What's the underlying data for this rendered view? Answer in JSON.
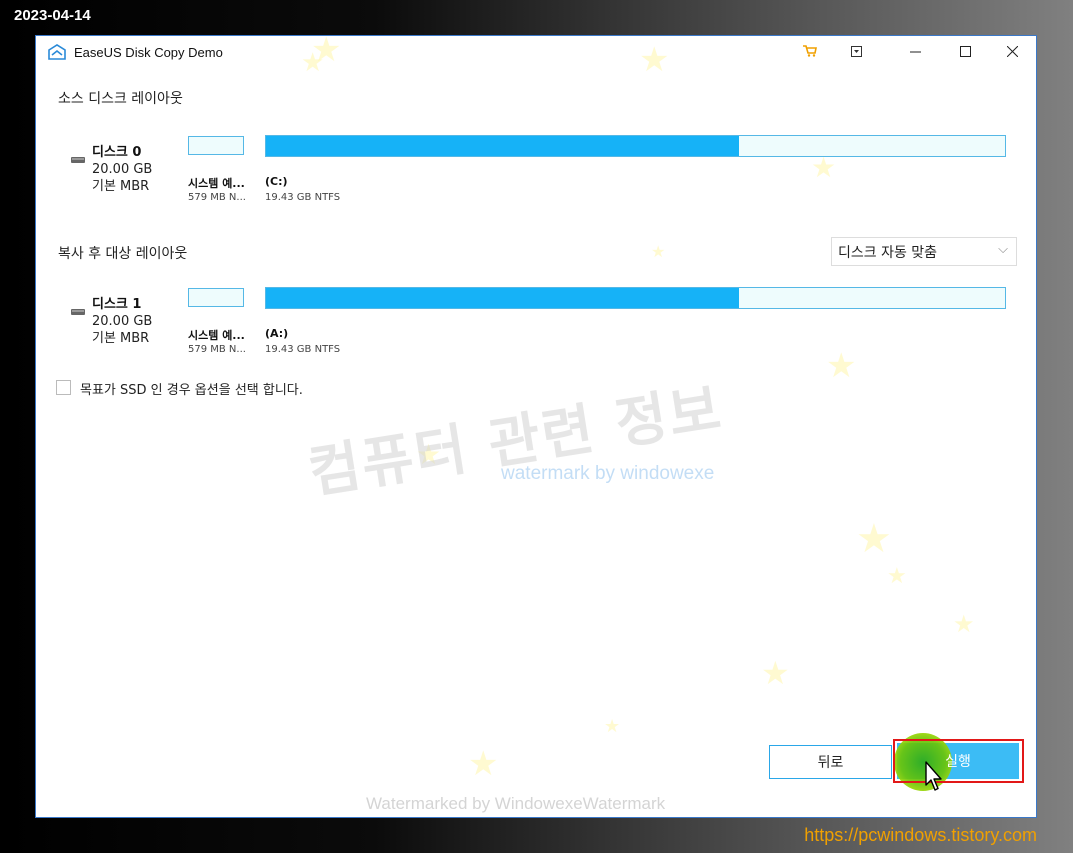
{
  "stamp": {
    "date": "2023-04-14"
  },
  "footer": {
    "site": "https://pcwindows.tistory.com"
  },
  "window": {
    "title": "EaseUS Disk Copy Demo",
    "controls": {
      "cart": "cart-icon",
      "menu": "menu-icon",
      "minimize": "minimize-icon",
      "maximize": "maximize-icon",
      "close": "close-icon"
    }
  },
  "source": {
    "heading": "소스 디스크 레이아웃",
    "disk": {
      "name": "디스크 0",
      "size": "20.00 GB",
      "type": "기본 MBR"
    },
    "partitions": [
      {
        "label": "시스템 예...",
        "info": "579 MB N...",
        "used_fraction": 0
      },
      {
        "label": "(C:)",
        "info": "19.43 GB NTFS",
        "used_fraction": 0.64
      }
    ]
  },
  "target": {
    "heading": "복사 후 대상 레이아웃",
    "layout_option": "디스크 자동 맞춤",
    "disk": {
      "name": "디스크 1",
      "size": "20.00 GB",
      "type": "기본 MBR"
    },
    "partitions": [
      {
        "label": "시스템 예...",
        "info": "579 MB N...",
        "used_fraction": 0
      },
      {
        "label": "(A:)",
        "info": "19.43 GB NTFS",
        "used_fraction": 0.64
      }
    ]
  },
  "ssd_option": {
    "label": "목표가 SSD 인 경우 옵션을 선택 합니다.",
    "checked": false
  },
  "watermarks": {
    "korean": "컴퓨터 관련 정보",
    "small": "watermark by windowexe",
    "bottom": "Watermarked by WindowexeWatermark"
  },
  "buttons": {
    "back": "뒤로",
    "run": "실행"
  },
  "colors": {
    "accent": "#16b2f7",
    "partition_border": "#55b8e6",
    "highlight": "#e21818"
  }
}
